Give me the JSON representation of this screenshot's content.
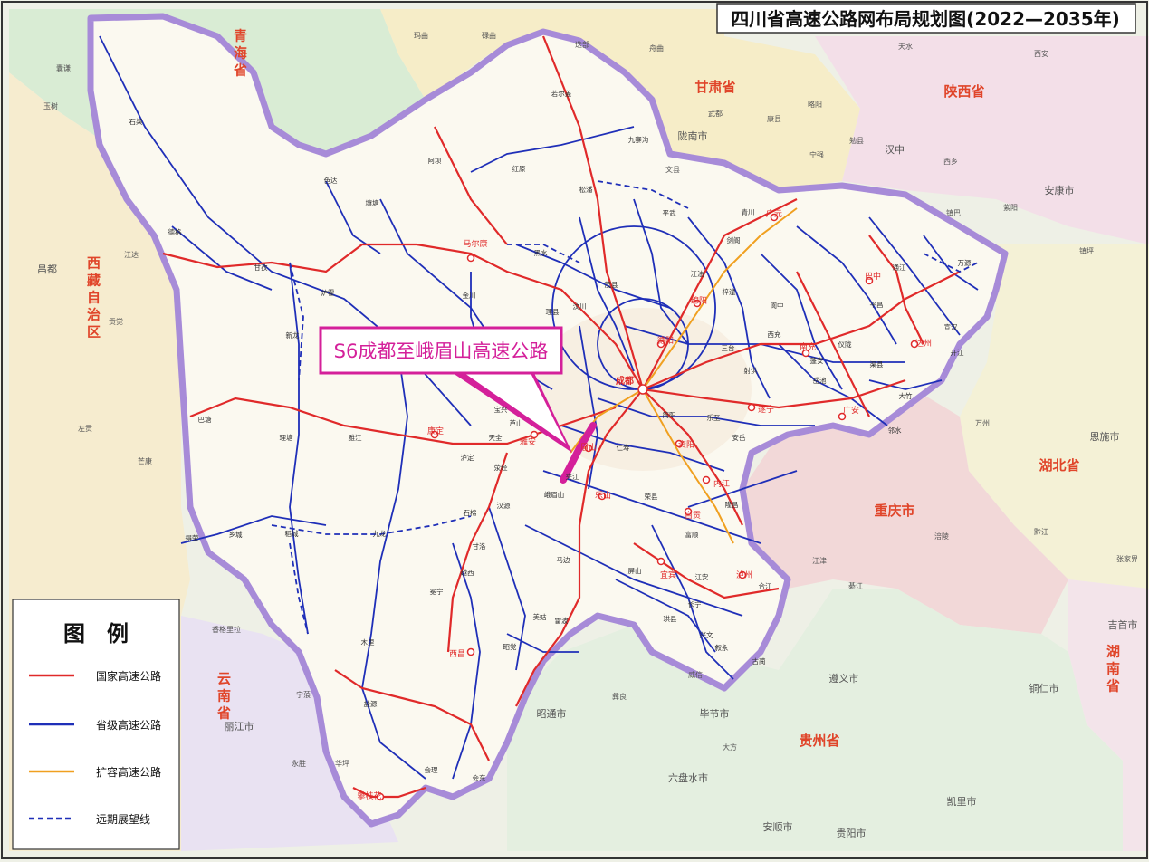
{
  "title": "四川省高速公路网布局规划图(2022—2035年)",
  "callout": "S6成都至峨眉山高速公路",
  "legend": {
    "heading": "图　例",
    "items": [
      {
        "label": "国家高速公路",
        "color": "#e02a2a",
        "dashed": false
      },
      {
        "label": "省级高速公路",
        "color": "#1f2fb8",
        "dashed": false
      },
      {
        "label": "扩容高速公路",
        "color": "#f0a020",
        "dashed": false
      },
      {
        "label": "远期展望线",
        "color": "#1f2fb8",
        "dashed": true
      }
    ]
  },
  "regions": {
    "qinghai": "青海省",
    "gansu": "甘肃省",
    "shaanxi": "陕西省",
    "tibet": "西藏自治区",
    "hubei": "湖北省",
    "chongqing": "重庆市",
    "yunnan": "云南省",
    "guizhou": "贵州省",
    "hunan": "湖南省"
  },
  "cities": {
    "chengdu": "成都",
    "mianyang": "绵阳",
    "deyang": "德阳",
    "guangyuan": "广元",
    "bazhong": "巴中",
    "dazhou": "达州",
    "nanchong": "南充",
    "suining": "遂宁",
    "guangan": "广安",
    "ziyang": "资阳",
    "meishan": "眉山",
    "leshan": "乐山",
    "yaan": "雅安",
    "neijiang": "内江",
    "zigong": "自贡",
    "yibin": "宜宾",
    "luzhou": "泸州",
    "xichang": "西昌",
    "panzhihua": "攀枝花",
    "maerkang": "马尔康",
    "kangding": "康定"
  },
  "towns": {
    "shiqu": "石渠",
    "dege": "德格",
    "ganzi": "甘孜",
    "seda": "色达",
    "rangtang": "壤塘",
    "aba": "阿坝",
    "hongyuan": "红原",
    "ruoergai": "若尔盖",
    "jiuzhaigou": "九寨沟",
    "songpan": "松潘",
    "maoxian": "茂县",
    "wenchuan": "汶川",
    "lixian": "理县",
    "heishui": "黑水",
    "jinchuan": "金川",
    "luhuo": "炉霍",
    "xinlong": "新龙",
    "litang": "理塘",
    "batang": "巴塘",
    "yajiang": "雅江",
    "daocheng": "稻城",
    "xiangcheng": "乡城",
    "derong": "得荣",
    "jiulong": "九龙",
    "luding": "泸定",
    "shimian": "石棉",
    "hanyuan": "汉源",
    "ganluo": "甘洛",
    "yuexi": "越西",
    "mianning": "冕宁",
    "muli": "木里",
    "yanyuan": "盐源",
    "huili": "会理",
    "huidong": "会东",
    "zhaojue": "昭觉",
    "meigu": "美姑",
    "leibo": "雷波",
    "mabian": "马边",
    "pingshan": "屏山",
    "jiangan": "江安",
    "xuyong": "叙永",
    "gulin": "古蔺",
    "lushan": "芦山",
    "baoxing": "宝兴",
    "tianquan": "天全",
    "yingjing": "荥经",
    "emeishan": "峨眉山",
    "jiajiang": "夹江",
    "renshou": "仁寿",
    "jianyang": "简阳",
    "santai": "三台",
    "zitong": "梓潼",
    "jiangyou": "江油",
    "pingwu": "平武",
    "qingchuan": "青川",
    "jiange": "剑阁",
    "langzhong": "阆中",
    "yilong": "仪陇",
    "pingchang": "平昌",
    "tongjiang": "通江",
    "wanyuan": "万源",
    "xuanhan": "宣汉",
    "kaijiang": "开江",
    "qu": "渠县",
    "dazhu": "大竹",
    "linshui": "邻水",
    "yuechi": "岳池",
    "pengan": "蓬安",
    "xichong": "西充",
    "shehong": "射洪",
    "anyue": "安岳",
    "lezhi": "乐至",
    "longchang": "隆昌",
    "rongxian": "荣县",
    "fushun": "富顺",
    "changning": "长宁",
    "gongxian": "珙县",
    "xingwen": "兴文",
    "hejiang": "合江"
  },
  "outside": {
    "yushu": "玉树",
    "nangqian": "囊谦",
    "changdu": "昌都",
    "gongjue": "贡觉",
    "jiangda": "江达",
    "zuogong": "左贡",
    "mangkang": "芒康",
    "shangrila": "香格里拉",
    "lijiang": "丽江市",
    "yongsheng": "永胜",
    "huaping": "华坪",
    "ninglang": "宁蒗",
    "zhaotong": "昭通市",
    "yiliang": "彝良",
    "weixin": "威信",
    "bijie": "毕节市",
    "dafang": "大方",
    "liupanshui": "六盘水市",
    "zunyi": "遵义市",
    "guiyang": "贵阳市",
    "anshun": "安顺市",
    "kaili": "凯里市",
    "tongren": "铜仁市",
    "longnan": "陇南市",
    "hanzhong": "汉中",
    "ankang": "安康市",
    "xian": "西安",
    "enshi": "恩施市",
    "jishou": "吉首市",
    "tianshui": "天水",
    "zhangjiajie": "张家界",
    "wanzhou": "万州",
    "fuling": "涪陵",
    "jiangjin": "江津",
    "qijiang": "綦江",
    "qianjiang": "黔江",
    "maqu": "玛曲",
    "luqu": "碌曲",
    "diebu": "迭部",
    "zhouqu": "舟曲",
    "wenxian": "文县",
    "wudu": "武都",
    "kangxian": "康县",
    "lueyang": "略阳",
    "ningqiang": "宁强",
    "mianxian": "勉县",
    "xixiang": "西乡",
    "zhenba": "镇巴",
    "ziyangsx": "紫阳",
    "zhenping": "镇坪"
  }
}
